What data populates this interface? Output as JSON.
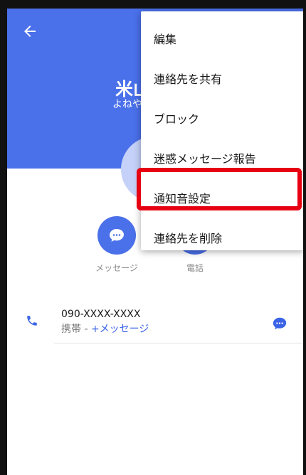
{
  "contact": {
    "name": "米山",
    "reading": "よねや"
  },
  "actions": {
    "message_label": "メッセージ",
    "call_label": "電話"
  },
  "phone_entry": {
    "number": "090-XXXX-XXXX",
    "type": "携帯 - ",
    "message_link": "+メッセージ"
  },
  "menu": {
    "items": [
      {
        "label": "編集"
      },
      {
        "label": "連絡先を共有"
      },
      {
        "label": "ブロック"
      },
      {
        "label": "迷惑メッセージ報告"
      },
      {
        "label": "通知音設定",
        "highlighted": true
      },
      {
        "label": "連絡先を削除"
      }
    ]
  },
  "icons": {
    "back": "arrow-left-icon",
    "phone": "phone-icon",
    "message": "chat-bubble-icon"
  },
  "colors": {
    "header": "#4a70ea",
    "accent": "#3a63e6",
    "highlight": "#e60012"
  }
}
